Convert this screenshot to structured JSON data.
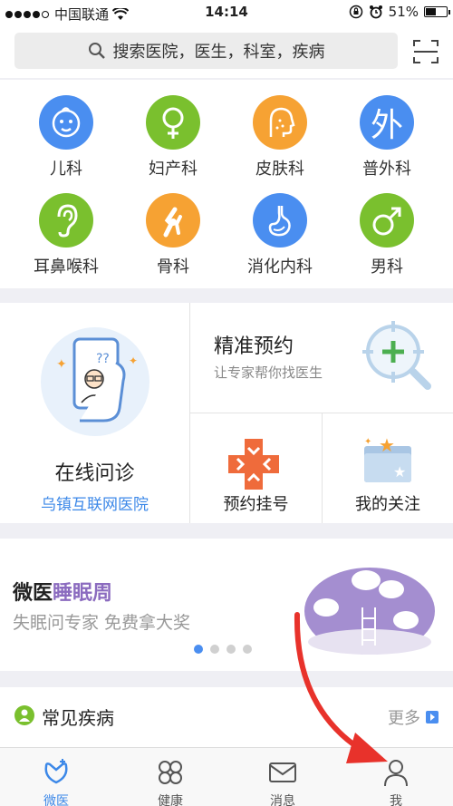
{
  "status_bar": {
    "carrier": "中国联通",
    "time": "14:14",
    "battery": "51%",
    "battery_level": 0.51
  },
  "search": {
    "placeholder": "搜索医院，医生，科室，疾病"
  },
  "departments": [
    {
      "label": "儿科",
      "icon": "baby-icon",
      "color": "#4a8ef0"
    },
    {
      "label": "妇产科",
      "icon": "female-icon",
      "color": "#7ac02e"
    },
    {
      "label": "皮肤科",
      "icon": "face-icon",
      "color": "#f6a233"
    },
    {
      "label": "普外科",
      "icon": "surgery-icon",
      "color": "#4a8ef0",
      "glyph": "外"
    },
    {
      "label": "耳鼻喉科",
      "icon": "ear-icon",
      "color": "#7ac02e"
    },
    {
      "label": "骨科",
      "icon": "bone-icon",
      "color": "#f6a233"
    },
    {
      "label": "消化内科",
      "icon": "stomach-icon",
      "color": "#4a8ef0"
    },
    {
      "label": "男科",
      "icon": "male-icon",
      "color": "#7ac02e"
    }
  ],
  "online": {
    "title": "在线问诊",
    "subtitle": "乌镇互联网医院"
  },
  "precise": {
    "title": "精准预约",
    "subtitle": "让专家帮你找医生",
    "glyph": "?"
  },
  "register": {
    "title": "预约挂号"
  },
  "follow": {
    "title": "我的关注"
  },
  "banner": {
    "brand": "微医",
    "highlight": "睡眠周",
    "subtitle": "失眠问专家 免费拿大奖",
    "dots": 4,
    "active_dot": 0
  },
  "common": {
    "title": "常见疾病",
    "more": "更多"
  },
  "tabbar": [
    {
      "label": "微医",
      "icon": "weiyi-icon",
      "active": true
    },
    {
      "label": "健康",
      "icon": "clover-icon",
      "active": false
    },
    {
      "label": "消息",
      "icon": "mail-icon",
      "active": false
    },
    {
      "label": "我",
      "icon": "person-icon",
      "active": false
    }
  ],
  "colors": {
    "accent": "#3c88e8",
    "green": "#7ac02e",
    "orange": "#f6a233",
    "purple": "#8b6bbf",
    "annotation_red": "#e8322b"
  }
}
